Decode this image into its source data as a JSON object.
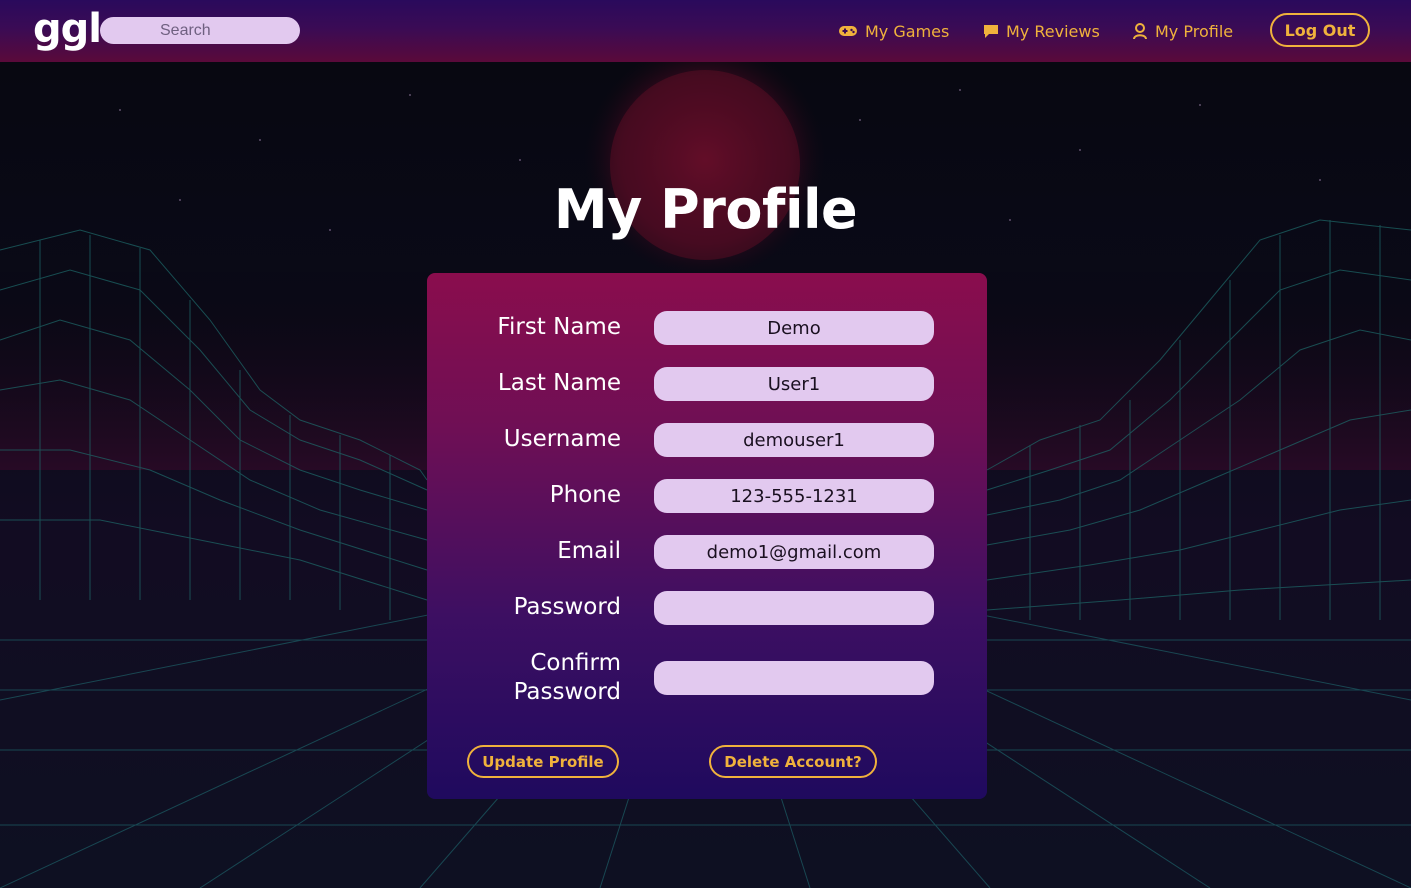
{
  "brand": {
    "logo_text": "ggl"
  },
  "search": {
    "placeholder": "Search",
    "value": ""
  },
  "nav": {
    "links": [
      {
        "label": "My Games",
        "icon": "gamepad-icon"
      },
      {
        "label": "My Reviews",
        "icon": "comment-icon"
      },
      {
        "label": "My Profile",
        "icon": "user-icon"
      }
    ],
    "logout_label": "Log Out"
  },
  "page": {
    "title": "My Profile"
  },
  "form": {
    "fields": [
      {
        "label": "First Name",
        "value": "Demo"
      },
      {
        "label": "Last Name",
        "value": "User1"
      },
      {
        "label": "Username",
        "value": "demouser1"
      },
      {
        "label": "Phone",
        "value": "123-555-1231"
      },
      {
        "label": "Email",
        "value": "demo1@gmail.com"
      },
      {
        "label": "Password",
        "value": ""
      },
      {
        "label_line1": "Confirm",
        "label_line2": "Password",
        "value": ""
      }
    ],
    "update_label": "Update Profile",
    "delete_label": "Delete Account?"
  },
  "colors": {
    "accent": "#f0b23c",
    "input_bg": "#e2c9ef",
    "nav_top": "#2a0a5c",
    "nav_bottom": "#5a0a3a",
    "card_top": "#8a0d4d",
    "card_bottom": "#1f0a5e"
  }
}
